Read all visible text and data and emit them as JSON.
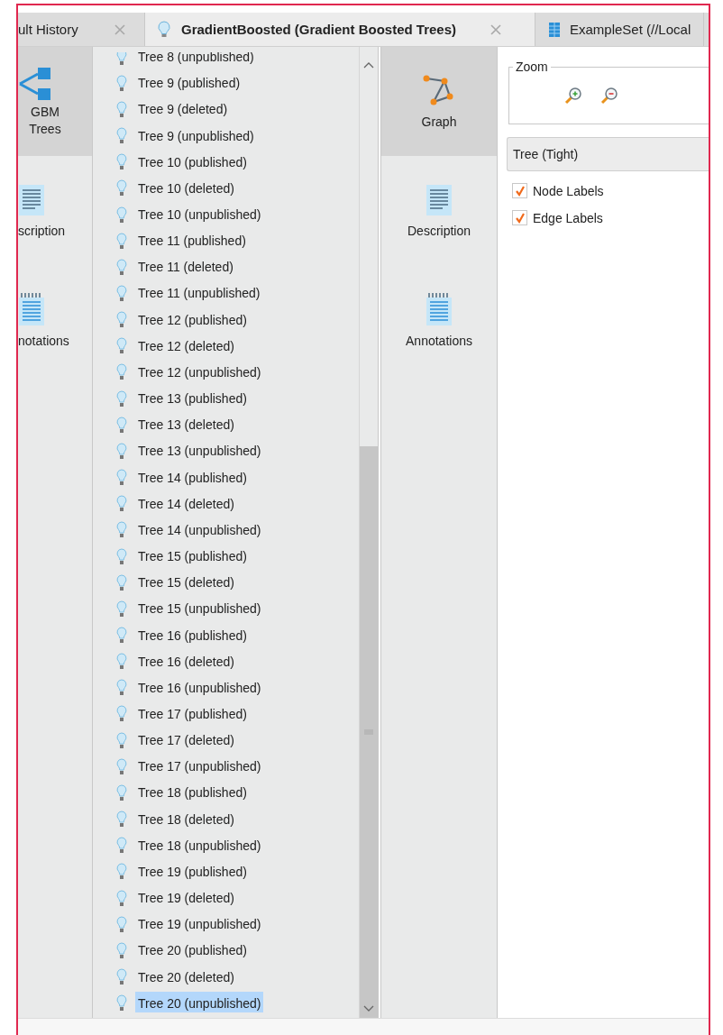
{
  "tabs": [
    {
      "label": "ult History",
      "kind": "plain",
      "selected": false
    },
    {
      "label": "GradientBoosted (Gradient Boosted Trees)",
      "kind": "model",
      "selected": true
    },
    {
      "label": "ExampleSet (//Local",
      "kind": "data",
      "selected": false
    }
  ],
  "left_sidebar": [
    {
      "label": "GBM Trees",
      "kind": "trees",
      "selected": true
    },
    {
      "label": "scription",
      "kind": "description",
      "selected": false
    },
    {
      "label": "notations",
      "kind": "annotations",
      "selected": false
    }
  ],
  "tree_list": [
    {
      "label": "Tree 8 (unpublished)",
      "selected": false
    },
    {
      "label": "Tree 9 (published)",
      "selected": false
    },
    {
      "label": "Tree 9 (deleted)",
      "selected": false
    },
    {
      "label": "Tree 9 (unpublished)",
      "selected": false
    },
    {
      "label": "Tree 10 (published)",
      "selected": false
    },
    {
      "label": "Tree 10 (deleted)",
      "selected": false
    },
    {
      "label": "Tree 10 (unpublished)",
      "selected": false
    },
    {
      "label": "Tree 11 (published)",
      "selected": false
    },
    {
      "label": "Tree 11 (deleted)",
      "selected": false
    },
    {
      "label": "Tree 11 (unpublished)",
      "selected": false
    },
    {
      "label": "Tree 12 (published)",
      "selected": false
    },
    {
      "label": "Tree 12 (deleted)",
      "selected": false
    },
    {
      "label": "Tree 12 (unpublished)",
      "selected": false
    },
    {
      "label": "Tree 13 (published)",
      "selected": false
    },
    {
      "label": "Tree 13 (deleted)",
      "selected": false
    },
    {
      "label": "Tree 13 (unpublished)",
      "selected": false
    },
    {
      "label": "Tree 14 (published)",
      "selected": false
    },
    {
      "label": "Tree 14 (deleted)",
      "selected": false
    },
    {
      "label": "Tree 14 (unpublished)",
      "selected": false
    },
    {
      "label": "Tree 15 (published)",
      "selected": false
    },
    {
      "label": "Tree 15 (deleted)",
      "selected": false
    },
    {
      "label": "Tree 15 (unpublished)",
      "selected": false
    },
    {
      "label": "Tree 16 (published)",
      "selected": false
    },
    {
      "label": "Tree 16 (deleted)",
      "selected": false
    },
    {
      "label": "Tree 16 (unpublished)",
      "selected": false
    },
    {
      "label": "Tree 17 (published)",
      "selected": false
    },
    {
      "label": "Tree 17 (deleted)",
      "selected": false
    },
    {
      "label": "Tree 17 (unpublished)",
      "selected": false
    },
    {
      "label": "Tree 18 (published)",
      "selected": false
    },
    {
      "label": "Tree 18 (deleted)",
      "selected": false
    },
    {
      "label": "Tree 18 (unpublished)",
      "selected": false
    },
    {
      "label": "Tree 19 (published)",
      "selected": false
    },
    {
      "label": "Tree 19 (deleted)",
      "selected": false
    },
    {
      "label": "Tree 19 (unpublished)",
      "selected": false
    },
    {
      "label": "Tree 20 (published)",
      "selected": false
    },
    {
      "label": "Tree 20 (deleted)",
      "selected": false
    },
    {
      "label": "Tree 20 (unpublished)",
      "selected": true
    }
  ],
  "view_tabs": [
    {
      "label": "Graph",
      "kind": "graph",
      "selected": true
    },
    {
      "label": "Description",
      "kind": "description",
      "selected": false
    },
    {
      "label": "Annotations",
      "kind": "annotations",
      "selected": false
    }
  ],
  "zoom": {
    "title": "Zoom"
  },
  "layout_dropdown": {
    "value": "Tree (Tight)"
  },
  "options": [
    {
      "label": "Node Labels",
      "checked": true
    },
    {
      "label": "Edge Labels",
      "checked": true
    }
  ]
}
